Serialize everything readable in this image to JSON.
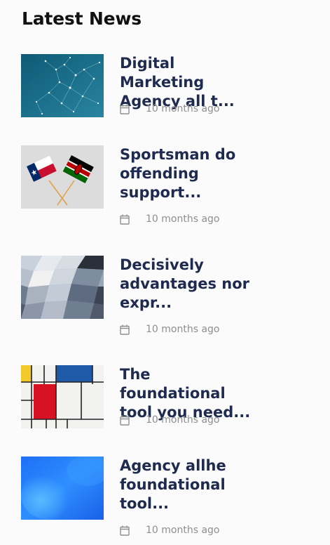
{
  "widget": {
    "title": "Latest News"
  },
  "news": [
    {
      "title": "Digital Marketing Agency all t...",
      "date": "10 months ago",
      "image": "network-nodes-image"
    },
    {
      "title": "Sportsman do offending support...",
      "date": "10 months ago",
      "image": "crossed-flags-image"
    },
    {
      "title": "Decisively advantages nor expr...",
      "date": "10 months ago",
      "image": "low-poly-image"
    },
    {
      "title": "The foundational tool you need...",
      "date": "10 months ago",
      "image": "mondrian-image"
    },
    {
      "title": "Agency allhe foundational tool...",
      "date": "10 months ago",
      "image": "blue-gradient-image"
    }
  ],
  "colors": {
    "title_text": "#111111",
    "news_title": "#1e2a4e",
    "meta_text": "#8f8f8f",
    "background": "#fbfbfb"
  },
  "icons": {
    "date": "calendar-icon"
  }
}
